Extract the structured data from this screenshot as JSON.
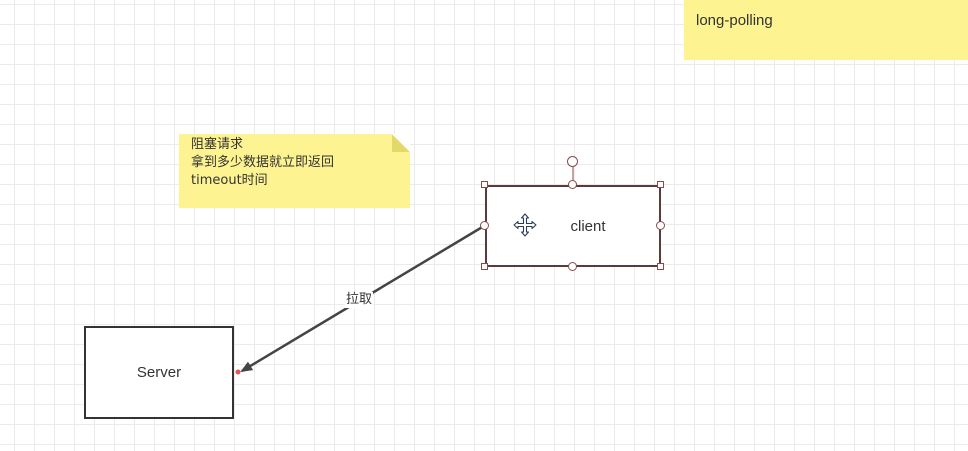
{
  "notes": {
    "top": "long-polling",
    "left": [
      "阻塞请求",
      "拿到多少数据就立即返回",
      "timeout时间"
    ]
  },
  "nodes": {
    "server": "Server",
    "client": "client"
  },
  "edge": {
    "label": "拉取"
  },
  "colors": {
    "note": "#fdf391",
    "grid": "#ebebeb",
    "selection_handle": "#8a4a4a",
    "arrow": "#444444"
  },
  "icons": [
    "move-cursor-icon",
    "rotate-handle-icon"
  ]
}
